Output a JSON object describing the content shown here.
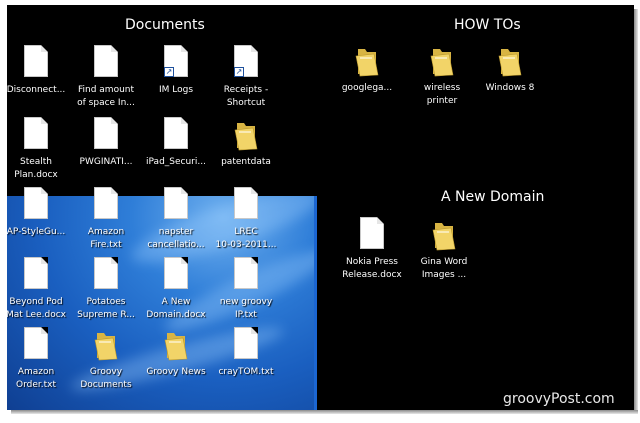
{
  "groups": {
    "documents": {
      "title": "Documents",
      "items": [
        {
          "label_1": "Disconnect...",
          "label_2": "",
          "type": "doc",
          "icon": "document-icon"
        },
        {
          "label_1": "Find amount",
          "label_2": "of space In...",
          "type": "doc",
          "icon": "document-icon"
        },
        {
          "label_1": "IM Logs",
          "label_2": "",
          "type": "shortcut",
          "icon": "shortcut-icon"
        },
        {
          "label_1": "Receipts -",
          "label_2": "Shortcut",
          "type": "shortcut",
          "icon": "shortcut-icon"
        },
        {
          "label_1": "Stealth",
          "label_2": "Plan.docx",
          "type": "doc",
          "icon": "document-icon"
        },
        {
          "label_1": "PWGINATI...",
          "label_2": "",
          "type": "doc",
          "icon": "document-icon"
        },
        {
          "label_1": "iPad_Securi...",
          "label_2": "",
          "type": "doc",
          "icon": "document-icon"
        },
        {
          "label_1": "patentdata",
          "label_2": "",
          "type": "folder",
          "icon": "folder-icon"
        },
        {
          "label_1": "AP-StyleGu...",
          "label_2": "",
          "type": "doc",
          "icon": "document-icon"
        },
        {
          "label_1": "Amazon",
          "label_2": "Fire.txt",
          "type": "doc",
          "icon": "document-icon"
        },
        {
          "label_1": "napster",
          "label_2": "cancellatio...",
          "type": "doc",
          "icon": "document-icon"
        },
        {
          "label_1": "LREC",
          "label_2": "10-03-2011...",
          "type": "doc",
          "icon": "document-icon"
        },
        {
          "label_1": "Beyond Pod",
          "label_2": "Mat Lee.docx",
          "type": "doc",
          "icon": "document-icon"
        },
        {
          "label_1": "Potatoes",
          "label_2": "Supreme R...",
          "type": "doc",
          "icon": "document-icon"
        },
        {
          "label_1": "A New",
          "label_2": "Domain.docx",
          "type": "doc",
          "icon": "document-icon"
        },
        {
          "label_1": "new groovy",
          "label_2": "IP.txt",
          "type": "doc",
          "icon": "document-icon"
        },
        {
          "label_1": "Amazon",
          "label_2": "Order.txt",
          "type": "doc",
          "icon": "document-icon"
        },
        {
          "label_1": "Groovy",
          "label_2": "Documents",
          "type": "folder",
          "icon": "folder-icon"
        },
        {
          "label_1": "Groovy News",
          "label_2": "",
          "type": "folder",
          "icon": "folder-icon"
        },
        {
          "label_1": "crayTOM.txt",
          "label_2": "",
          "type": "doc",
          "icon": "document-icon"
        }
      ]
    },
    "howtos": {
      "title": "HOW TOs",
      "items": [
        {
          "label_1": "googlega...",
          "label_2": "",
          "type": "folder",
          "icon": "folder-icon"
        },
        {
          "label_1": "wireless",
          "label_2": "printer",
          "type": "folder",
          "icon": "folder-icon"
        },
        {
          "label_1": "Windows 8",
          "label_2": "",
          "type": "folder",
          "icon": "folder-icon"
        }
      ]
    },
    "newdomain": {
      "title": "A New Domain",
      "items": [
        {
          "label_1": "Nokia Press",
          "label_2": "Release.docx",
          "type": "doc",
          "icon": "document-icon"
        },
        {
          "label_1": "Gina Word",
          "label_2": "Images ...",
          "type": "folder",
          "icon": "folder-icon"
        }
      ]
    }
  },
  "watermark": "groovyPost.com",
  "colors": {
    "desktop_bg": "#000000",
    "wallpaper_blue": "#1a5fc0",
    "folder_yellow": "#f0cf5a"
  }
}
